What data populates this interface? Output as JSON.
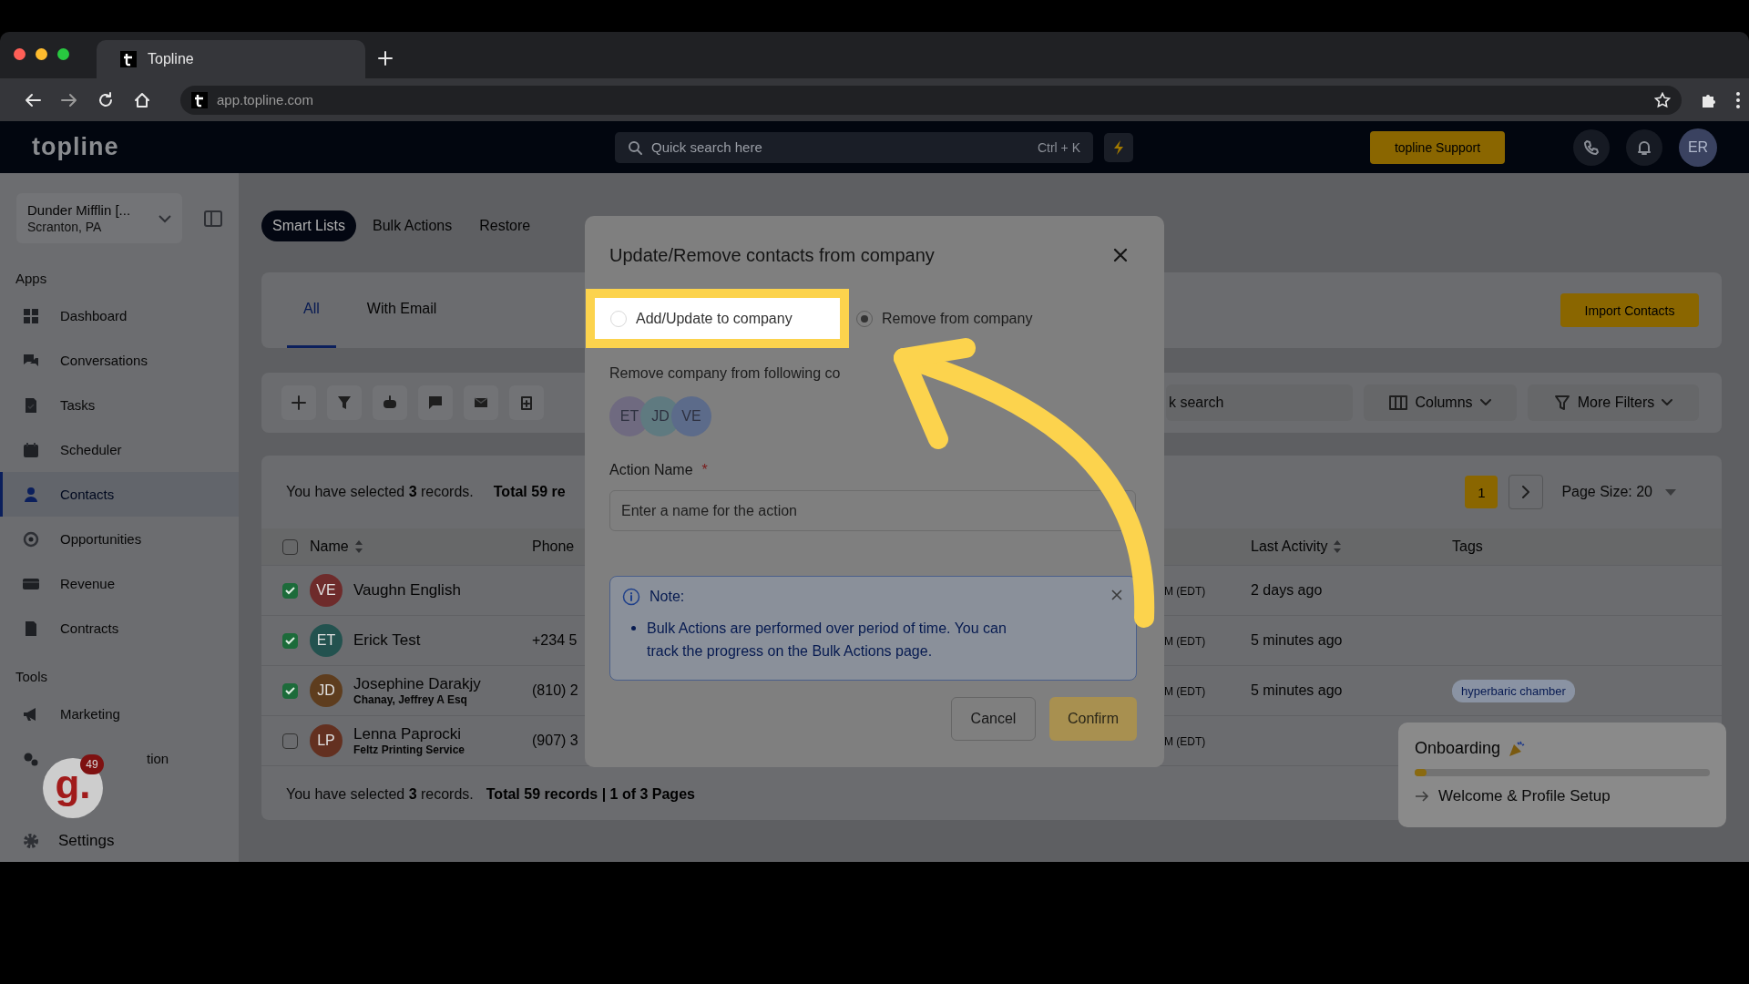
{
  "browser": {
    "tab_title": "Topline",
    "url": "app.topline.com"
  },
  "header": {
    "logo": "topline",
    "search": {
      "placeholder": "Quick search here"
    },
    "shortcut": "Ctrl + K",
    "support_button": "topline Support",
    "avatar": "ER"
  },
  "sidebar": {
    "account": {
      "name": "Dunder Mifflin [...",
      "location": "Scranton, PA"
    },
    "sections": [
      {
        "title": "Apps",
        "items": [
          {
            "label": "Dashboard",
            "selected": false
          },
          {
            "label": "Conversations",
            "selected": false
          },
          {
            "label": "Tasks",
            "selected": false
          },
          {
            "label": "Scheduler",
            "selected": false
          },
          {
            "label": "Contacts",
            "selected": true
          },
          {
            "label": "Opportunities",
            "selected": false
          },
          {
            "label": "Revenue",
            "selected": false
          },
          {
            "label": "Contracts",
            "selected": false
          }
        ]
      },
      {
        "title": "Tools",
        "items": [
          {
            "label": "Marketing",
            "selected": false
          },
          {
            "label": "tion",
            "selected": false
          }
        ]
      }
    ],
    "settings": "Settings"
  },
  "tabs": [
    {
      "label": "Smart Lists",
      "selected": true
    },
    {
      "label": "Bulk Actions",
      "selected": false
    },
    {
      "label": "Restore",
      "selected": false
    }
  ],
  "list_tabs": [
    {
      "label": "All",
      "selected": true
    },
    {
      "label": "With Email",
      "selected": false
    }
  ],
  "import_button": "Import Contacts",
  "toolbar": {
    "search": {
      "placeholder": "k search"
    },
    "columns_button": "Columns",
    "filters_button": "More Filters"
  },
  "table": {
    "selection_note": "You have selected **3** records.",
    "total": "Total 59 re",
    "page": "1",
    "page_size": "Page Size: 20",
    "columns": [
      "Name",
      "Phone",
      "Last Activity",
      "Tags"
    ],
    "all_selected": false,
    "rows": [
      {
        "checked": true,
        "initials": "VE",
        "color": "#6e2b2b",
        "name": "Vaughn English",
        "time": "M (EDT)",
        "last_activity": "2 days ago"
      },
      {
        "checked": true,
        "initials": "ET",
        "color": "#23524f",
        "name": "Erick Test",
        "phone": "+234 5",
        "time": "M (EDT)",
        "last_activity": "5 minutes ago"
      },
      {
        "checked": true,
        "initials": "JD",
        "color": "#5e3d1e",
        "name": "Josephine Darakjy",
        "company": "Chanay, Jeffrey A Esq",
        "phone": "(810) 2",
        "time": "M (EDT)",
        "last_activity": "5 minutes ago",
        "tag": "hyperbaric chamber"
      },
      {
        "checked": false,
        "initials": "LP",
        "color": "#633020",
        "name": "Lenna Paprocki",
        "company": "Feltz Printing Service",
        "phone": "(907) 3",
        "time": "M (EDT)"
      }
    ],
    "footer_note": "You have selected **3** records.",
    "footer_total": "Total 59 records | 1 of 3 Pages"
  },
  "modal": {
    "title": "Update/Remove contacts from company",
    "options": [
      {
        "label": "Add/Update to company",
        "selected": false,
        "highlighted": true
      },
      {
        "label": "Remove from company",
        "selected": true,
        "highlighted": false
      }
    ],
    "contacts_label": "Remove company from following co",
    "contacts": [
      {
        "initials": "ET",
        "color": "#6f6a80"
      },
      {
        "initials": "JD",
        "color": "#5f7a80"
      },
      {
        "initials": "VE",
        "color": "#5c6b8a"
      }
    ],
    "action_name_label": "Action Name",
    "required_mark": "*",
    "action_name": {
      "placeholder": "Enter a name for the action"
    },
    "note": {
      "title": "Note:",
      "items": [
        "Bulk Actions are performed over period of time. You can track the progress on the Bulk Actions page."
      ]
    },
    "cancel_button": "Cancel",
    "confirm_button": {
      "label": "Confirm",
      "disabled": true
    }
  },
  "onboarding": {
    "title": "Onboarding",
    "level": 0.04,
    "step": "Welcome & Profile Setup"
  },
  "widget": {
    "letter": "g.",
    "badge": "49"
  }
}
